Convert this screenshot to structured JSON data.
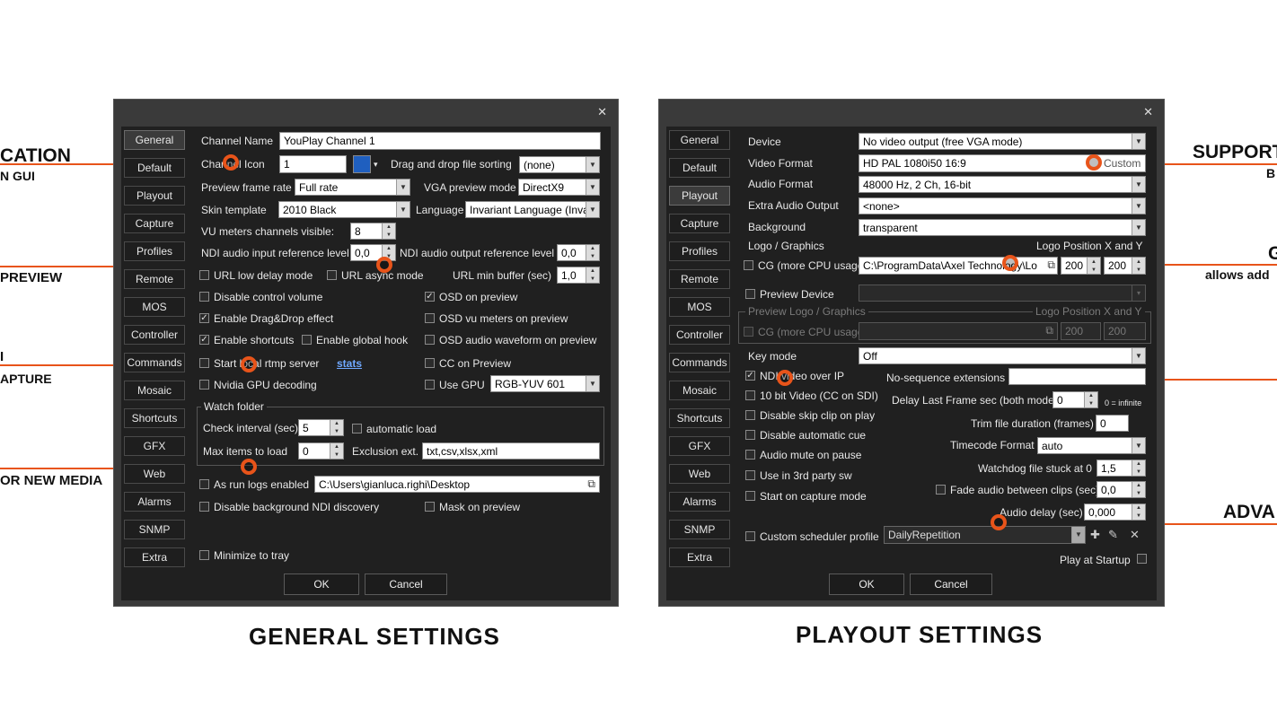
{
  "callouts": {
    "left": [
      {
        "title": "CATION",
        "sub": "N GUI"
      },
      {
        "title": "PREVIEW",
        "sub": ""
      },
      {
        "title": "I",
        "sub": "APTURE"
      },
      {
        "title": "OR NEW MEDIA",
        "sub": ""
      }
    ],
    "right": [
      {
        "title": "SUPPORT",
        "sub": "B"
      },
      {
        "title": "G",
        "sub": "allows add"
      },
      {
        "title": "ADVA",
        "sub": ""
      }
    ]
  },
  "captions": {
    "general": "GENERAL SETTINGS",
    "playout": "PLAYOUT SETTINGS"
  },
  "nav": [
    "General",
    "Default",
    "Playout",
    "Capture",
    "Profiles",
    "Remote",
    "MOS",
    "Controller",
    "Commands",
    "Mosaic",
    "Shortcuts",
    "GFX",
    "Web",
    "Alarms",
    "SNMP",
    "Extra"
  ],
  "buttons": {
    "ok": "OK",
    "cancel": "Cancel"
  },
  "general": {
    "channel_name_label": "Channel Name",
    "channel_name": "YouPlay Channel 1",
    "channel_icon_label": "Channel Icon",
    "channel_icon": "1",
    "dnd_sorting_label": "Drag and drop file sorting",
    "dnd_sorting": "(none)",
    "preview_rate_label": "Preview frame rate",
    "preview_rate": "Full rate",
    "vga_mode_label": "VGA preview mode",
    "vga_mode": "DirectX9",
    "skin_label": "Skin template",
    "skin": "2010 Black",
    "language_label": "Language",
    "language": "Invariant Language (Inva",
    "vu_label": "VU meters channels visible:",
    "vu": "8",
    "ndi_in_label": "NDI audio input reference level",
    "ndi_in": "0,0",
    "ndi_out_label": "NDI audio output reference level",
    "ndi_out": "0,0",
    "url_low_delay": "URL low delay mode",
    "url_async": "URL async mode",
    "url_min_buffer_label": "URL min buffer (sec)",
    "url_min_buffer": "1,0",
    "disable_control_volume": "Disable control volume",
    "osd_preview": "OSD on preview",
    "enable_dnd": "Enable Drag&Drop effect",
    "osd_vu": "OSD vu meters on preview",
    "enable_shortcuts": "Enable shortcuts",
    "enable_global_hook": "Enable global hook",
    "osd_waveform": "OSD audio waveform on preview",
    "start_rtmp": "Start local rtmp server",
    "stats": "stats",
    "cc_preview": "CC on Preview",
    "nvidia": "Nvidia GPU decoding",
    "use_gpu": "Use GPU",
    "gpu_mode": "RGB-YUV 601",
    "watch_folder_label": "Watch folder",
    "check_interval_label": "Check interval (sec)",
    "check_interval": "5",
    "automatic_load": "automatic load",
    "max_items_label": "Max items to load",
    "max_items": "0",
    "exclusion_label": "Exclusion ext.",
    "exclusion": "txt,csv,xlsx,xml",
    "as_run": "As run logs enabled",
    "as_run_path": "C:\\Users\\gianluca.righi\\Desktop",
    "disable_ndi_discovery": "Disable background NDI discovery",
    "mask_preview": "Mask on preview",
    "minimize_tray": "Minimize to tray"
  },
  "playout": {
    "device_label": "Device",
    "device": "No video output (free VGA mode)",
    "video_format_label": "Video Format",
    "video_format": "HD PAL 1080i50 16:9",
    "custom": "Custom",
    "audio_format_label": "Audio Format",
    "audio_format": "48000 Hz, 2 Ch, 16-bit",
    "extra_audio_label": "Extra Audio Output",
    "extra_audio": "<none>",
    "background_label": "Background",
    "background": "transparent",
    "logo_graphics_label": "Logo / Graphics",
    "logo_pos_label": "Logo Position X and Y",
    "cg_label": "CG (more CPU usage)",
    "cg_path": "C:\\ProgramData\\Axel Technology\\Lo",
    "logo_x": "200",
    "logo_y": "200",
    "preview_device_label": "Preview Device",
    "preview_logo_label": "Preview Logo / Graphics",
    "preview_logo_pos_label": "Logo Position X and Y",
    "preview_cg_label": "CG (more CPU usage)",
    "preview_x": "200",
    "preview_y": "200",
    "key_mode_label": "Key mode",
    "key_mode": "Off",
    "ndi_video": "NDI video over IP",
    "no_sequence_label": "No-sequence extensions",
    "ten_bit": "10 bit Video (CC on SDI)",
    "delay_last_label": "Delay Last Frame sec (both mode)",
    "delay_last": "0",
    "infinite_note": "0 = infinite",
    "disable_skip": "Disable skip clip on play",
    "trim_label": "Trim file duration (frames)",
    "trim": "0",
    "disable_cue": "Disable automatic cue",
    "timecode_label": "Timecode Format",
    "timecode": "auto",
    "audio_mute": "Audio mute on pause",
    "watchdog_label": "Watchdog file stuck at 0",
    "watchdog": "1,5",
    "third_party": "Use in 3rd party sw",
    "fade_audio_label": "Fade audio between clips (sec)",
    "fade_audio": "0,0",
    "start_capture": "Start on capture mode",
    "audio_delay_label": "Audio delay (sec)",
    "audio_delay": "0,000",
    "custom_scheduler_label": "Custom scheduler profile",
    "scheduler_profile": "DailyRepetition",
    "play_startup": "Play at Startup"
  }
}
